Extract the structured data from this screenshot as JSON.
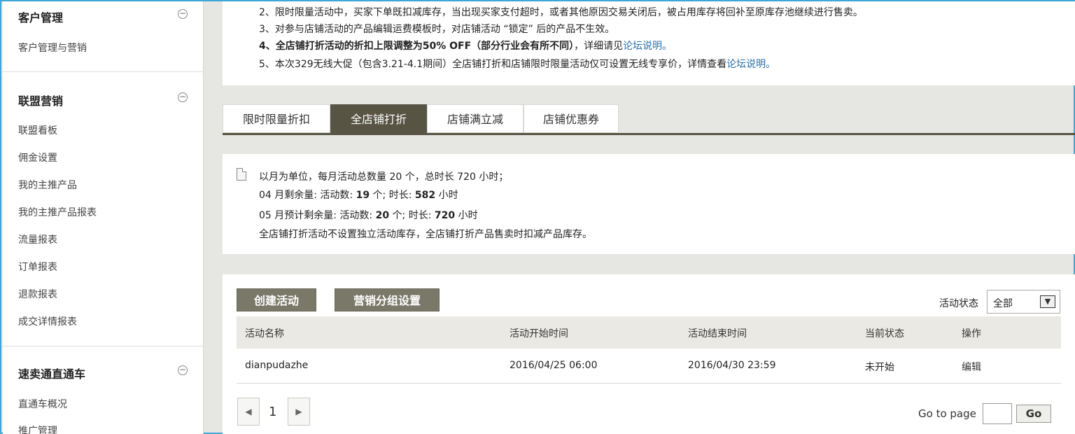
{
  "sidebar": {
    "sections": [
      {
        "title": "客户管理",
        "toggle": "−",
        "items": [
          "客户管理与营销"
        ]
      },
      {
        "title": "联盟营销",
        "toggle": "−",
        "items": [
          "联盟看板",
          "佣金设置",
          "我的主推产品",
          "我的主推产品报表",
          "流量报表",
          "订单报表",
          "退款报表",
          "成交详情报表"
        ]
      },
      {
        "title": "速卖通直通车",
        "toggle": "−",
        "items": [
          "直通车概况",
          "推广管理"
        ]
      }
    ]
  },
  "notice": {
    "line2": "2、限时限量活动中，买家下单既扣减库存，当出现买家支付超时，或者其他原因交易关闭后，被占用库存将回补至原库存池继续进行售卖。",
    "line3": "3、对参与店铺活动的产品编辑运费模板时，对店铺活动 “锁定” 后的产品不生效。",
    "line4_bold": "4、全店铺打折活动的折扣上限调整为50% OFF（部分行业会有所不同）",
    "line4_rest": "，详细请见",
    "line4_link": "论坛说明。",
    "line5": "5、本次329无线大促（包含3.21-4.1期间）全店铺打折和店铺限时限量活动仅可设置无线专享价，详情查看",
    "line5_link": "论坛说明。"
  },
  "tabs": [
    "限时限量折扣",
    "全店铺打折",
    "店铺满立减",
    "店铺优惠券"
  ],
  "active_tab": "全店铺打折",
  "info": {
    "line1": "以月为单位，每月活动总数量 20 个，总时长 720 小时；",
    "line2_prefix": "04 月剩余量: 活动数: ",
    "line2_count": "19",
    "line2_mid": " 个; 时长: ",
    "line2_hours": "582",
    "line2_suffix": " 小时",
    "line3_prefix": "05 月预计剩余量: 活动数: ",
    "line3_count": "20",
    "line3_mid": " 个; 时长: ",
    "line3_hours": "720",
    "line3_suffix": " 小时",
    "line4": "全店铺打折活动不设置独立活动库存，全店铺打折产品售卖时扣减产品库存。"
  },
  "actions": {
    "create": "创建活动",
    "group_settings": "营销分组设置"
  },
  "status_filter": {
    "label": "活动状态",
    "value": "全部",
    "arrow_icon": "chevron-down-icon"
  },
  "table": {
    "headers": [
      "活动名称",
      "活动开始时间",
      "活动结束时间",
      "当前状态",
      "操作"
    ],
    "rows": [
      {
        "name": "dianpudazhe",
        "start": "2016/04/25 06:00",
        "end": "2016/04/30 23:59",
        "status": "未开始",
        "action": "编辑"
      }
    ]
  },
  "pager": {
    "current": "1",
    "goto_label": "Go to page",
    "go": "Go",
    "prev_icon": "◀",
    "next_icon": "▶"
  }
}
